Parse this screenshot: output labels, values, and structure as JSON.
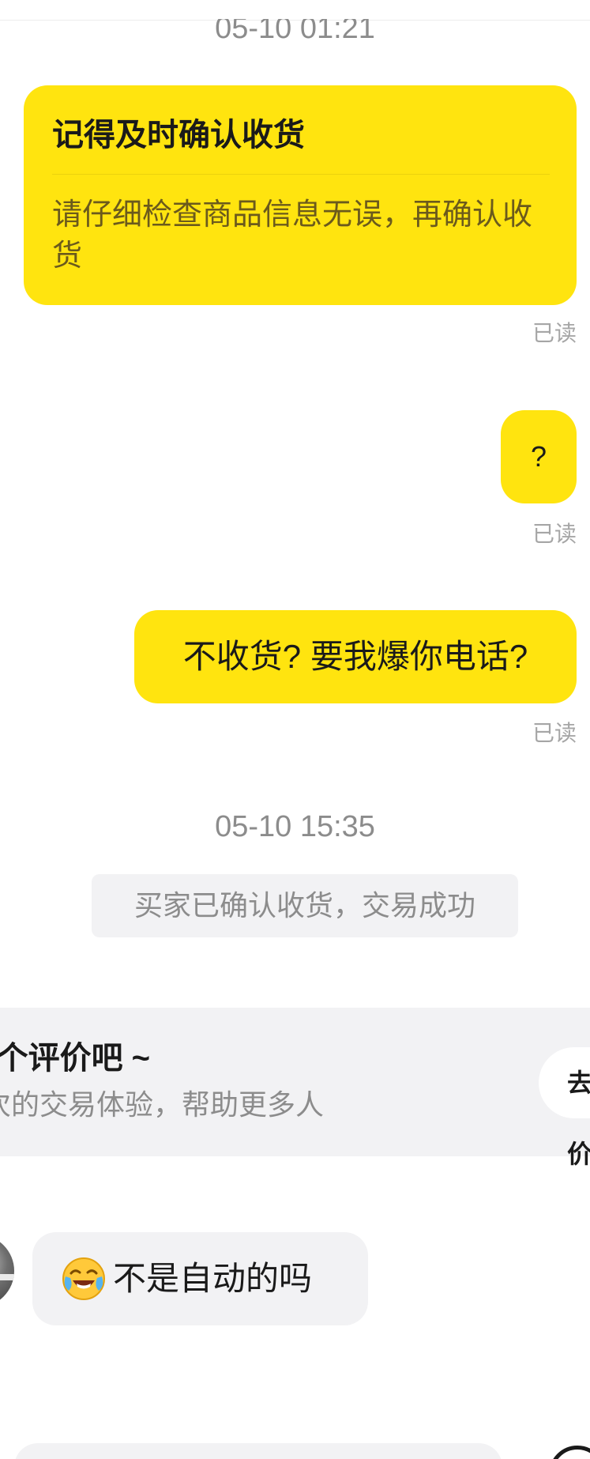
{
  "messages": {
    "timestamp_1": "05-10 01:21",
    "reminder_card": {
      "title": "记得及时确认收货",
      "body": "请仔细检查商品信息无误，再确认收货"
    },
    "read_label": "已读",
    "question_bubble": "?",
    "threat_bubble": "不收货? 要我爆你电话?",
    "timestamp_2": "05-10 15:35",
    "system_notice": "买家已确认收货，交易成功",
    "buyer_bubble": "不是自动的吗",
    "buyer_emoji": "crying-laughing-emoji"
  },
  "review_prompt": {
    "title": "给ta一个评价吧 ~",
    "subtitle": "分享这次的交易体验，帮助更多人",
    "button_label": "去评价"
  },
  "colors": {
    "seller_bubble": "#ffe40f",
    "buyer_bubble": "#f2f2f4",
    "muted_text": "#8c8c8c"
  }
}
